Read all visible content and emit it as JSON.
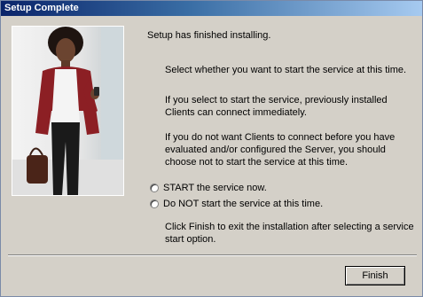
{
  "window": {
    "title": "Setup Complete"
  },
  "content": {
    "finished": "Setup has finished installing.",
    "select_prompt": "Select whether you want to start the service at this time.",
    "start_info": "If you select to start the service, previously installed Clients can connect immediately.",
    "dont_start_info": "If you do not want Clients to connect before you have evaluated and/or configured the Server, you should choose not to start the service at this time.",
    "finish_instructions": "Click Finish to exit the installation after selecting a service start option."
  },
  "options": [
    {
      "label": "START the service now.",
      "selected": false
    },
    {
      "label": "Do NOT start the service at this time.",
      "selected": false
    }
  ],
  "buttons": {
    "finish": "Finish"
  }
}
